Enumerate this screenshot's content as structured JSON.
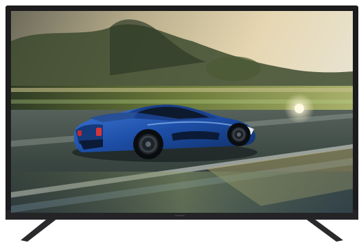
{
  "scene": {
    "subject": "television-product-photo",
    "screen_content": "blue-sports-car-on-race-track",
    "colors": {
      "bezel": "#1c1c1e",
      "stand": "#2a2a2c",
      "car_body": "#1d4fa8",
      "sky": "#d8c9a6",
      "track": "#3d4a3a",
      "sun_glow": "#fff4c8"
    }
  }
}
